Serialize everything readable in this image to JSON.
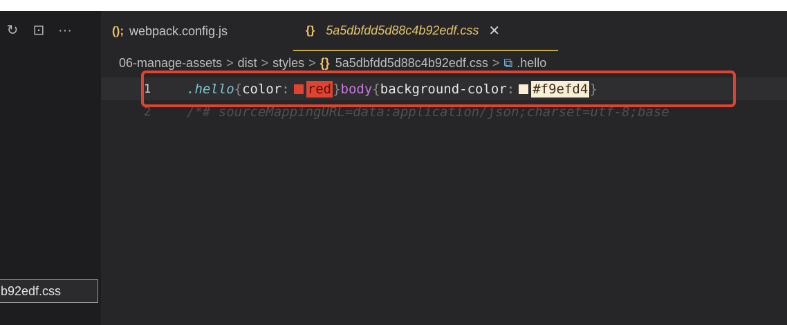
{
  "sidebar": {
    "tool_icons": [
      "↻",
      "⊡",
      "···"
    ],
    "file_entry": "b92edf.css"
  },
  "tabs": [
    {
      "icon": "();",
      "label": "webpack.config.js"
    },
    {
      "icon": "{}",
      "label": "5a5dbfdd5d88c4b92edf.css",
      "close": "✕"
    }
  ],
  "breadcrumb": {
    "parts": [
      "06-manage-assets",
      "dist",
      "styles",
      "5a5dbfdd5d88c4b92edf.css",
      ".hello"
    ],
    "separator": ">",
    "file_icon": "{}",
    "symbol_icon": "⧉"
  },
  "code": {
    "line1": {
      "number": "1",
      "selector": ".hello",
      "open_brace": "{",
      "prop1": "color",
      "colon": ":",
      "val1": "red",
      "close_brace": "}",
      "body": "body",
      "open_brace2": "{",
      "prop2": "background-color",
      "colon2": ":",
      "val2": "#f9efd4",
      "close_brace2": "}"
    },
    "line2": {
      "number": "2",
      "text": "/*# sourceMappingURL=data:application/json;charset=utf-8;base"
    }
  },
  "colors": {
    "highlight_border": "#e0432f",
    "swatch_red": "#e0432f",
    "swatch_hex": "#f9efd4",
    "accent_tab": "#e3c26b"
  }
}
